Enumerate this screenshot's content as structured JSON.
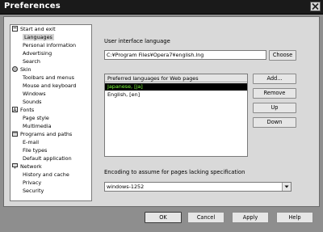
{
  "window": {
    "title": "Preferences"
  },
  "tree": [
    {
      "label": "Start and exit",
      "level": 0,
      "icon": "start-icon"
    },
    {
      "label": "Languages",
      "level": 1,
      "selected": true
    },
    {
      "label": "Personal information",
      "level": 1
    },
    {
      "label": "Advertising",
      "level": 1
    },
    {
      "label": "Search",
      "level": 1
    },
    {
      "label": "Skin",
      "level": 0,
      "icon": "skin-icon"
    },
    {
      "label": "Toolbars and menus",
      "level": 1
    },
    {
      "label": "Mouse and keyboard",
      "level": 1
    },
    {
      "label": "Windows",
      "level": 1
    },
    {
      "label": "Sounds",
      "level": 1
    },
    {
      "label": "Fonts",
      "level": 0,
      "icon": "fonts-icon"
    },
    {
      "label": "Page style",
      "level": 1
    },
    {
      "label": "Multimedia",
      "level": 1
    },
    {
      "label": "Programs and paths",
      "level": 0,
      "icon": "programs-icon"
    },
    {
      "label": "E-mail",
      "level": 1
    },
    {
      "label": "File types",
      "level": 1
    },
    {
      "label": "Default application",
      "level": 1
    },
    {
      "label": "Network",
      "level": 0,
      "icon": "network-icon"
    },
    {
      "label": "History and cache",
      "level": 1
    },
    {
      "label": "Privacy",
      "level": 1
    },
    {
      "label": "Security",
      "level": 1
    }
  ],
  "ui_language": {
    "label": "User interface language",
    "value": "C:¥Program Files¥Opera7¥english.lng",
    "choose_label": "Choose"
  },
  "preferred": {
    "header": "Preferred languages for Web pages",
    "rows": [
      {
        "label": "Japanese, [ja]",
        "selected": true
      },
      {
        "label": "English, [en]"
      }
    ],
    "add_label": "Add...",
    "remove_label": "Remove",
    "up_label": "Up",
    "down_label": "Down"
  },
  "encoding": {
    "label": "Encoding to assume for pages lacking specification",
    "value": "windows-1252"
  },
  "footer": {
    "ok_label": "OK",
    "cancel_label": "Cancel",
    "apply_label": "Apply",
    "help_label": "Help"
  },
  "colors": {
    "selection_bg": "#000000",
    "selection_fg": "#7dff3a"
  }
}
